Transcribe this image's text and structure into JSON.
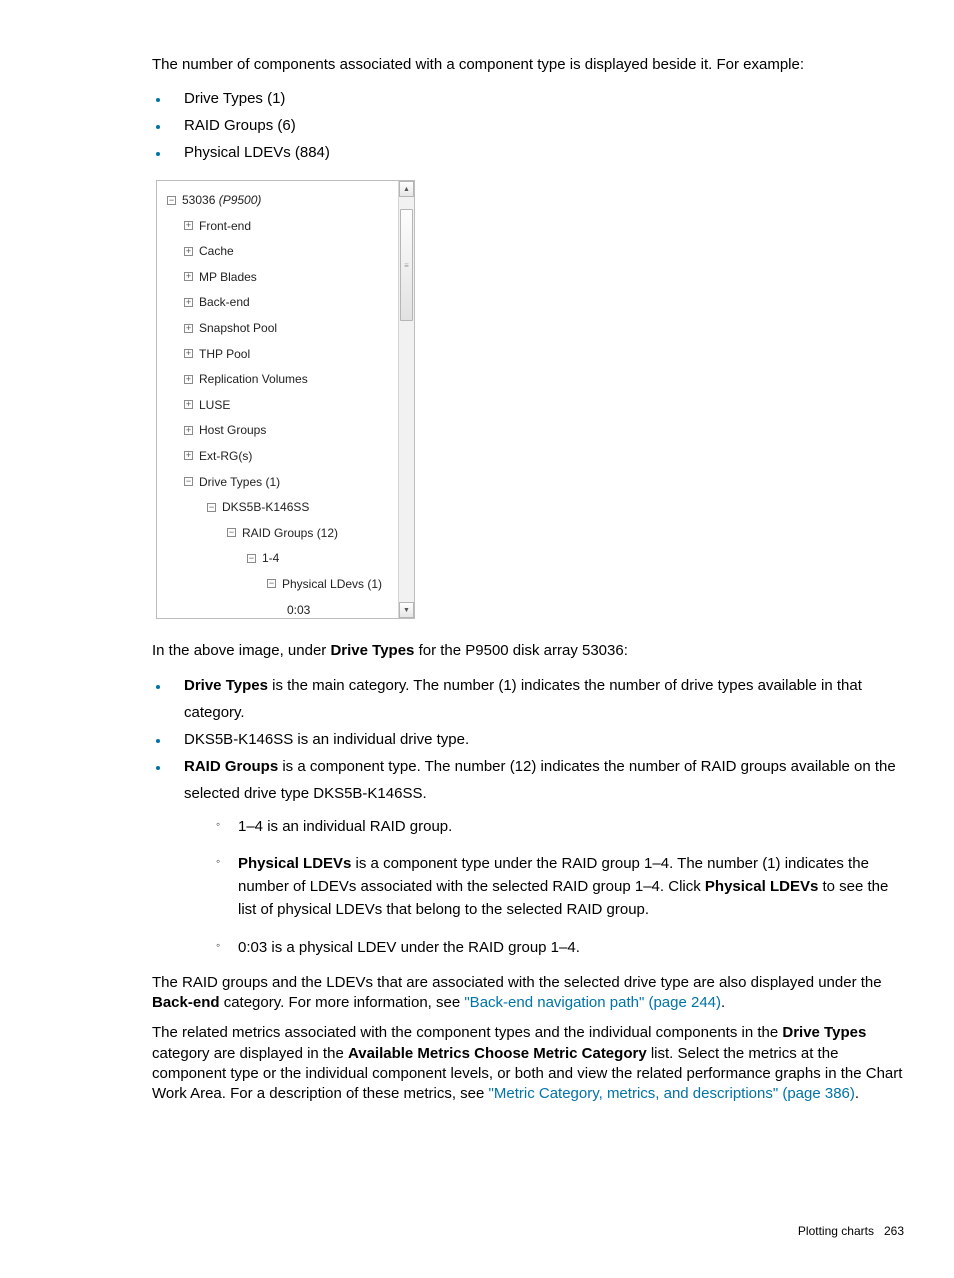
{
  "intro": "The number of components associated with a component type is displayed beside it. For example:",
  "examples": [
    "Drive Types (1)",
    "RAID Groups (6)",
    "Physical LDEVs (884)"
  ],
  "tree": {
    "root_main": "53036 ",
    "root_model": "(P9500)",
    "nodes": [
      "Front-end",
      "Cache",
      "MP Blades",
      "Back-end",
      "Snapshot Pool",
      "THP Pool",
      "Replication Volumes",
      "LUSE",
      "Host Groups",
      "Ext-RG(s)"
    ],
    "drive_types": "Drive Types (1)",
    "drive_type_item": "DKS5B-K146SS",
    "raid_groups": "RAID Groups (12)",
    "rg_item": "1-4",
    "pldevs": "Physical LDevs (1)",
    "ldev_item": "0:03"
  },
  "caption_prefix": "In the above image, under ",
  "caption_bold": "Drive Types",
  "caption_suffix": " for the P9500 disk array 53036:",
  "bullets2": {
    "b1_bold": "Drive Types",
    "b1_rest": " is the main category. The number (1) indicates the number of drive types available in that category.",
    "b2": "DKS5B-K146SS is an individual drive type.",
    "b3_bold": "RAID Groups",
    "b3_rest": " is a component type. The number (12) indicates the number of RAID groups available on the selected drive type DKS5B-K146SS.",
    "sub1": "1–4 is an individual RAID group.",
    "sub2_bold": "Physical LDEVs",
    "sub2_mid": " is a component type under the RAID group 1–4. The number (1) indicates the number of LDEVs associated with the selected RAID group 1–4. Click ",
    "sub2_bold2": "Physical LDEVs",
    "sub2_end": " to see the list of physical LDEVs that belong to the selected RAID group.",
    "sub3": "0:03 is a physical LDEV under the RAID group 1–4."
  },
  "p_after_1a": "The RAID groups and the LDEVs that are associated with the selected drive type are also displayed under the ",
  "p_after_1_bold": "Back-end",
  "p_after_1b": " category. For more information, see ",
  "link1": "\"Back-end navigation path\" (page 244)",
  "p_after_1c": ".",
  "p2a": "The related metrics associated with the component types and the individual components in the ",
  "p2_bold1": "Drive Types",
  "p2b": " category are displayed in the ",
  "p2_bold2": "Available Metrics Choose Metric Category",
  "p2c": " list. Select the metrics at the component type or the individual component levels, or both and view the related performance graphs in the Chart Work Area. For a description of these metrics, see ",
  "link2": "\"Metric Category, metrics, and descriptions\" (page 386)",
  "p2d": ".",
  "footer_label": "Plotting charts",
  "footer_page": "263"
}
